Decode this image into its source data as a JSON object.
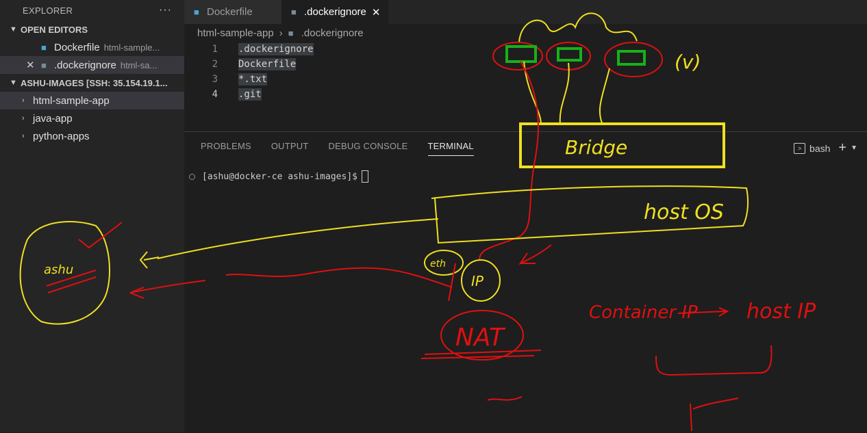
{
  "explorer": {
    "title": "EXPLORER",
    "more": "···",
    "open_editors": {
      "heading": "OPEN EDITORS",
      "items": [
        {
          "name": "Dockerfile",
          "path": "html-sample..."
        },
        {
          "name": ".dockerignore",
          "path": "html-sa..."
        }
      ]
    },
    "workspace": {
      "heading": "ASHU-IMAGES [SSH: 35.154.19.1...",
      "folders": [
        "html-sample-app",
        "java-app",
        "python-apps"
      ]
    }
  },
  "tabs": [
    {
      "label": "Dockerfile"
    },
    {
      "label": ".dockerignore",
      "close": "✕"
    }
  ],
  "breadcrumb": {
    "folder": "html-sample-app",
    "file": ".dockerignore"
  },
  "code_lines": [
    {
      "num": "1",
      "text": ".dockerignore"
    },
    {
      "num": "2",
      "text": "Dockerfile"
    },
    {
      "num": "3",
      "text": "*.txt"
    },
    {
      "num": "4",
      "text": ".git"
    }
  ],
  "panel": {
    "tabs": [
      "PROBLEMS",
      "OUTPUT",
      "DEBUG CONSOLE",
      "TERMINAL"
    ],
    "shell": "bash",
    "add": "+"
  },
  "terminal": {
    "prompt": "[ashu@docker-ce ashu-images]$"
  },
  "annotations": {
    "bridge": "Bridge",
    "host_os": "host OS",
    "nat": "NAT",
    "container_ip": "Container IP",
    "host_ip": "host IP",
    "user": "ashu",
    "eth": "eth",
    "ip": "IP",
    "v": "(v)"
  },
  "colors": {
    "annotation_red": "#e01010",
    "annotation_yellow": "#f0e020",
    "annotation_green": "#18b018"
  }
}
